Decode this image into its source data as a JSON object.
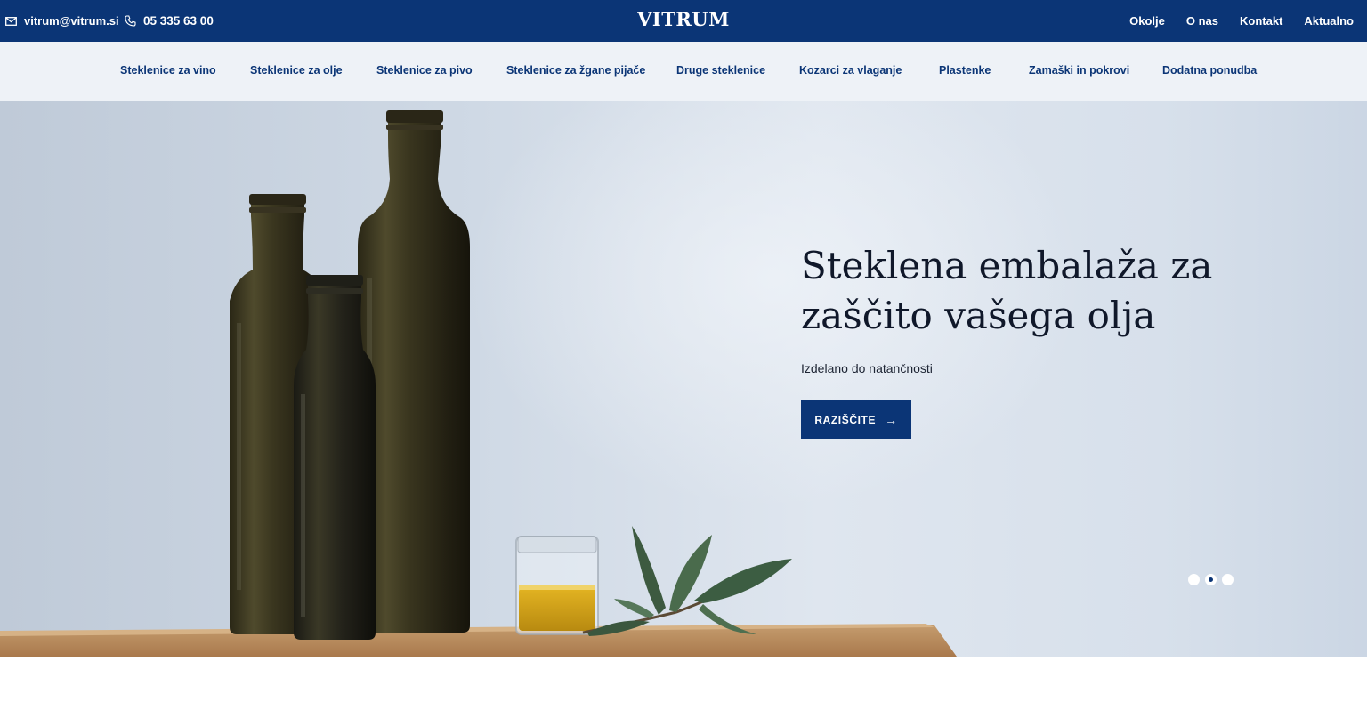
{
  "topbar": {
    "email": "vitrum@vitrum.si",
    "phone": "05 335 63 00",
    "brand": "VITRUM",
    "links": [
      "Okolje",
      "O nas",
      "Kontakt",
      "Aktualno"
    ],
    "background_color": "#0b3576"
  },
  "catnav": {
    "items": [
      "Steklenice za vino",
      "Steklenice za olje",
      "Steklenice za pivo",
      "Steklenice za žgane pijače",
      "Druge steklenice",
      "Kozarci za vlaganje",
      "Plastenke",
      "Zamaški in pokrovi",
      "Dodatna ponudba"
    ]
  },
  "hero": {
    "title_line1": "Steklena embalaža za",
    "title_line2": "zaščito vašega olja",
    "subtitle": "Izdelano do natančnosti",
    "button_label": "RAZIŠČITE",
    "slides_total": 3,
    "active_slide": 2
  },
  "icons": {
    "email": "envelope-icon",
    "phone": "phone-icon",
    "button_arrow": "arrow-right-icon"
  }
}
